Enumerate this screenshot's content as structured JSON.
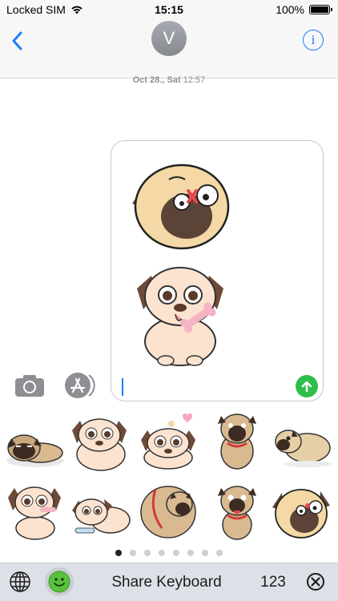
{
  "status_bar": {
    "carrier": "Locked SIM",
    "time": "15:15",
    "battery": "100%",
    "battery_level": 1.0
  },
  "header": {
    "contact_initial": "V",
    "back_icon": "chevron-left-icon",
    "info_icon": "info-icon"
  },
  "thread": {
    "timestamp_date": "Oct 28., Sat",
    "timestamp_time": "12:57"
  },
  "compose": {
    "preview_stickers": [
      "pug-tongue-out-dizzy",
      "pug-holding-bone"
    ],
    "send_icon": "arrow-up-icon",
    "camera_icon": "camera-icon",
    "appstore_icon": "app-store-icon"
  },
  "stickers": {
    "items": [
      "pug-lying-down",
      "pug-chubby-sitting",
      "pug-with-heart",
      "pug-standing-collar",
      "pug-side-collar",
      "pug-with-bone",
      "pug-bone-lying",
      "pug-round-collar",
      "pug-tongue-out",
      "pug-face-dizzy"
    ],
    "page_count": 8,
    "active_page": 1
  },
  "bottom_bar": {
    "share_label": "Share Keyboard",
    "numbers_label": "123",
    "globe_icon": "globe-icon",
    "emoji_icon": "smiley-icon",
    "delete_icon": "delete-icon"
  },
  "colors": {
    "accent": "#1a7ef8",
    "send": "#2fbe4a",
    "keyboard_bar": "#dde0e6",
    "pug_fawn": "#f4d9a6",
    "pug_dark": "#5b4337"
  }
}
